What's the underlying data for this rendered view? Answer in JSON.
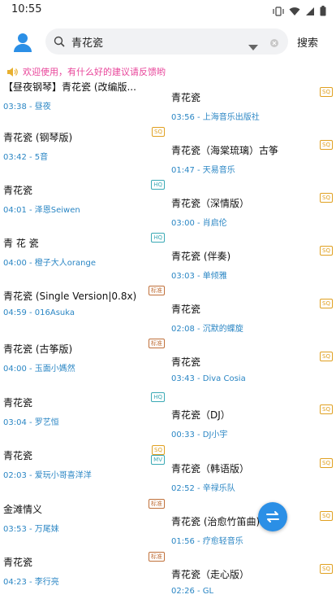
{
  "status_bar": {
    "time": "10:55"
  },
  "header": {
    "search_value": "青花瓷",
    "search_button": "搜索"
  },
  "notice": {
    "text": "欢迎使用，有什么好的建议请反馈哟"
  },
  "badge_colors": {
    "SQ": "#e0a020",
    "HQ": "#3aa9b5",
    "MV": "#3aa9b5",
    "标准": "#c0703a"
  },
  "results_left": [
    {
      "title": "【昼夜钢琴】青花瓷 (改编版...",
      "meta": "03:38 - 昼夜",
      "badge": ""
    },
    {
      "title": "青花瓷 (钢琴版)",
      "meta": "03:42 - 5音",
      "badge": "SQ"
    },
    {
      "title": "青花瓷",
      "meta": "04:01 - 泽恩Seiwen",
      "badge": "HQ"
    },
    {
      "title": "青 花 瓷",
      "meta": "04:00 - 橙子大人orange",
      "badge": "HQ"
    },
    {
      "title": "青花瓷 (Single Version|0.8x)",
      "meta": "04:59 - 016Asuka",
      "badge": "标准"
    },
    {
      "title": "青花瓷 (古筝版)",
      "meta": "04:00 - 玉面小媽然",
      "badge": "标准"
    },
    {
      "title": "青花瓷",
      "meta": "03:04 - 罗艺恒",
      "badge": "HQ"
    },
    {
      "title": "青花瓷",
      "meta": "02:03 - 爱玩小哥喜洋洋",
      "badge": "SQ",
      "badge2": "MV"
    },
    {
      "title": "金滩情义",
      "meta": "03:53 - 万尾妹",
      "badge": "标准"
    },
    {
      "title": "青花瓷",
      "meta": "04:23 - 李行亮",
      "badge": "标准"
    }
  ],
  "results_right": [
    {
      "title": "青花瓷",
      "meta": "03:56 - 上海音乐出版社",
      "badge": "SQ"
    },
    {
      "title": "青花瓷（海棠琉璃）古筝",
      "meta": "01:47 - 天易音乐",
      "badge": "SQ"
    },
    {
      "title": "青花瓷（深情版）",
      "meta": "03:00 - 肖启伦",
      "badge": "SQ"
    },
    {
      "title": "青花瓷 (伴奏)",
      "meta": "03:03 - 单倾雅",
      "badge": "SQ"
    },
    {
      "title": "青花瓷",
      "meta": "02:08 - 沉默的蝶旋",
      "badge": "SQ"
    },
    {
      "title": "青花瓷",
      "meta": "03:43 - Diva Cosia",
      "badge": "SQ"
    },
    {
      "title": "青花瓷（DJ）",
      "meta": "00:33 - DJ小宇",
      "badge": "SQ"
    },
    {
      "title": "青花瓷（韩语版）",
      "meta": "02:52 - 辛禄乐队",
      "badge": "SQ"
    },
    {
      "title": "青花瓷 (治愈竹笛曲)",
      "meta": "01:56 - 疗愈轻音乐",
      "badge": "SQ"
    },
    {
      "title": "青花瓷（走心版）",
      "meta": "02:26 - GL",
      "badge": "SQ"
    }
  ]
}
